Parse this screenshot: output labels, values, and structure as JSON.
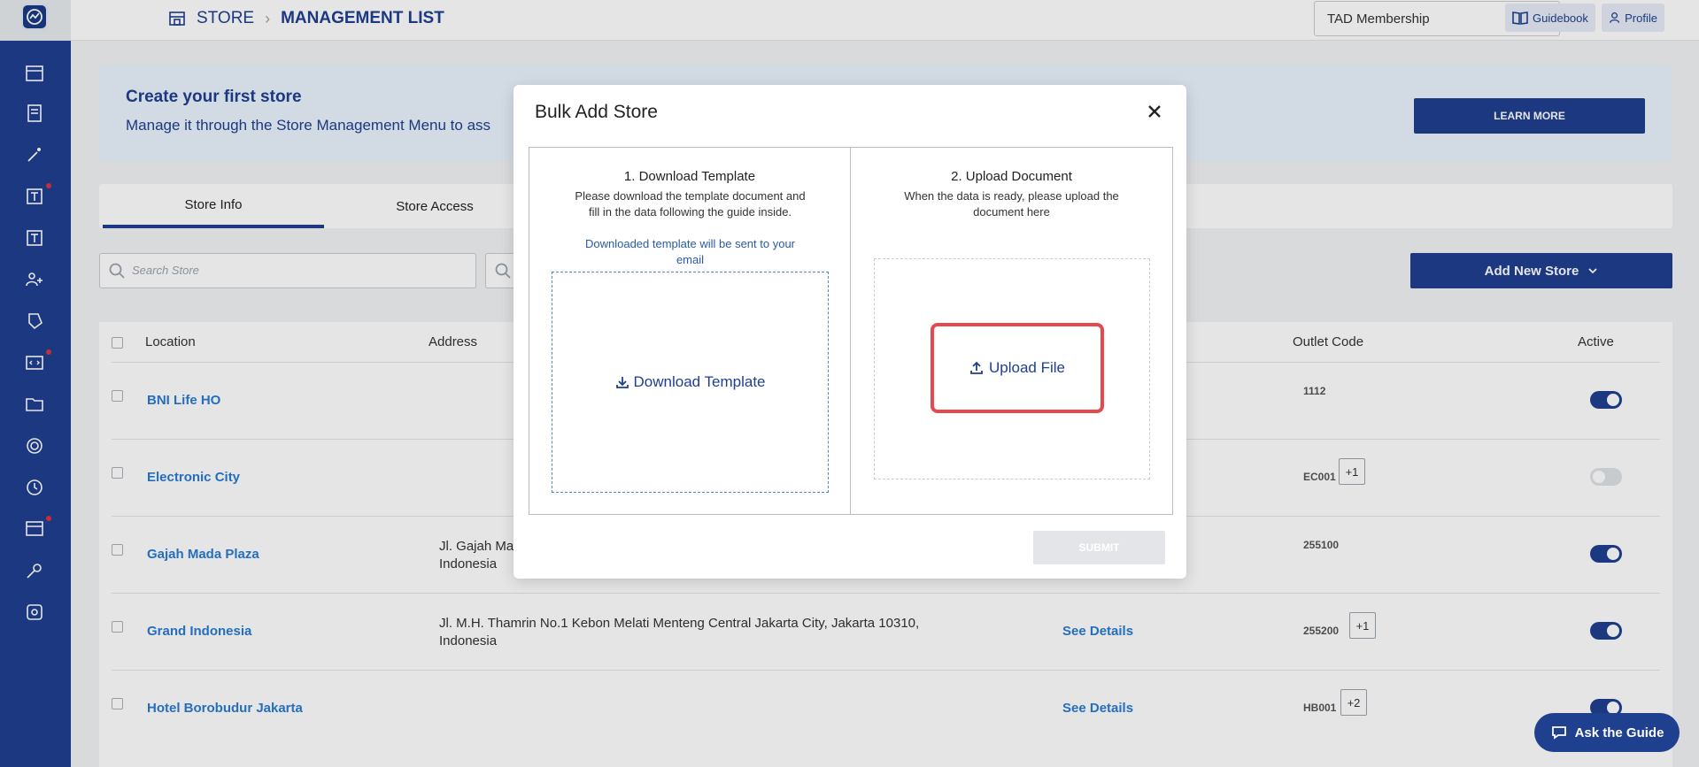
{
  "sidebar": {
    "icons": [
      {
        "name": "store-icon",
        "badge": false
      },
      {
        "name": "receipt-icon",
        "badge": false
      },
      {
        "name": "magic-wand-icon",
        "badge": false
      },
      {
        "name": "voucher-icon",
        "badge": true
      },
      {
        "name": "voucher-list-icon",
        "badge": false
      },
      {
        "name": "team-icon",
        "badge": false
      },
      {
        "name": "tag-icon",
        "badge": false
      },
      {
        "name": "developer-icon",
        "badge": true
      },
      {
        "name": "folder-icon",
        "badge": false
      },
      {
        "name": "target-icon",
        "badge": false
      },
      {
        "name": "history-icon",
        "badge": false
      },
      {
        "name": "billing-icon",
        "badge": true
      },
      {
        "name": "key-icon",
        "badge": false
      },
      {
        "name": "settings-icon",
        "badge": false
      }
    ]
  },
  "header": {
    "breadcrumb_root": "STORE",
    "breadcrumb_current": "MANAGEMENT LIST",
    "membership_value": "TAD Membership",
    "guidebook_label": "Guidebook",
    "profile_label": "Profile"
  },
  "banner": {
    "title": "Create your first store",
    "subtitle": "Manage it through the Store Management Menu to ass",
    "learn_more": "LEARN MORE"
  },
  "tabs": [
    "Store Info",
    "Store Access"
  ],
  "search": {
    "placeholder": "Search Store"
  },
  "add_store_label": "Add New Store",
  "table": {
    "headers": {
      "location": "Location",
      "address": "Address",
      "outlet_code": "Outlet Code",
      "active": "Active"
    },
    "rows": [
      {
        "name": "BNI Life HO",
        "address": "",
        "details": "",
        "code": "1112",
        "more": "",
        "active": true
      },
      {
        "name": "Electronic City",
        "address": "",
        "details": "",
        "code": "EC001",
        "more": "+1",
        "active": false
      },
      {
        "name": "Gajah Mada Plaza",
        "address": "Jl. Gajah Mad\nIndonesia",
        "details": "",
        "code": "255100",
        "more": "",
        "active": true
      },
      {
        "name": "Grand Indonesia",
        "address": "Jl. M.H. Thamrin No.1 Kebon Melati Menteng Central Jakarta City, Jakarta 10310, Indonesia",
        "details": "See Details",
        "code": "255200",
        "more": "+1",
        "active": true
      },
      {
        "name": "Hotel Borobudur Jakarta",
        "address": "",
        "details": "See Details",
        "code": "HB001",
        "more": "+2",
        "active": true
      }
    ]
  },
  "modal": {
    "title": "Bulk Add Store",
    "step1_title": "1. Download Template",
    "step1_desc": "Please download the template document and fill in the data following the guide inside.",
    "step1_note": "Downloaded template will be sent to your email",
    "download_label": "Download Template",
    "step2_title": "2. Upload Document",
    "step2_desc": "When the data is ready, please upload the document here",
    "upload_label": "Upload File",
    "submit_label": "SUBMIT"
  },
  "ask_guide": "Ask the Guide",
  "colors": {
    "primary": "#1f3f8f",
    "link": "#2a7bd4",
    "highlight": "#e5484d"
  }
}
